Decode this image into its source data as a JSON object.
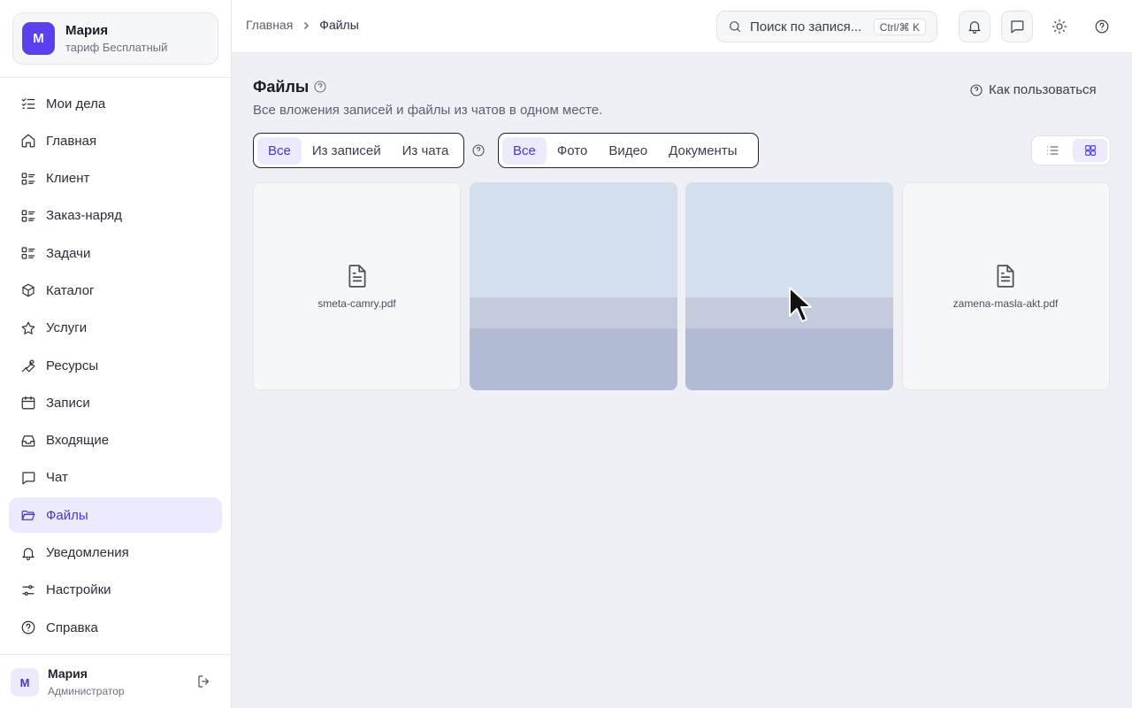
{
  "profile": {
    "initial": "М",
    "name": "Мария",
    "plan": "тариф Бесплатный"
  },
  "sidebar": {
    "items": [
      {
        "label": "Мои дела",
        "icon": "list-check-icon"
      },
      {
        "label": "Главная",
        "icon": "home-icon"
      },
      {
        "label": "Клиент",
        "icon": "list-icon"
      },
      {
        "label": "Заказ-наряд",
        "icon": "list-icon"
      },
      {
        "label": "Задачи",
        "icon": "list-icon"
      },
      {
        "label": "Каталог",
        "icon": "box-icon"
      },
      {
        "label": "Услуги",
        "icon": "star-icon"
      },
      {
        "label": "Ресурсы",
        "icon": "wrench-icon"
      },
      {
        "label": "Записи",
        "icon": "calendar-icon"
      },
      {
        "label": "Входящие",
        "icon": "inbox-icon"
      },
      {
        "label": "Чат",
        "icon": "chat-icon"
      },
      {
        "label": "Файлы",
        "icon": "folder-icon",
        "active": true
      },
      {
        "label": "Уведомления",
        "icon": "bell-icon"
      },
      {
        "label": "Настройки",
        "icon": "sliders-icon"
      },
      {
        "label": "Справка",
        "icon": "help-circle-icon"
      }
    ]
  },
  "user": {
    "initial": "М",
    "name": "Мария",
    "role": "Администратор"
  },
  "topbar": {
    "breadcrumb": {
      "home": "Главная",
      "current": "Файлы"
    },
    "search_placeholder": "Поиск по записям",
    "search_display": "Поиск по запися...",
    "shortcut": "Ctrl/⌘ K"
  },
  "page": {
    "title": "Файлы",
    "subtitle": "Все вложения записей и файлы из чатов в одном месте.",
    "howto": "Как пользоваться"
  },
  "source_filter": {
    "options": [
      "Все",
      "Из записей",
      "Из чата"
    ],
    "selected": "Все"
  },
  "type_filter": {
    "options": [
      "Все",
      "Фото",
      "Видео",
      "Документы"
    ],
    "selected": "Все"
  },
  "view_mode": "grid",
  "files": [
    {
      "kind": "document",
      "name": "smeta-camry.pdf"
    },
    {
      "kind": "image"
    },
    {
      "kind": "image"
    },
    {
      "kind": "document",
      "name": "zamena-masla-akt.pdf"
    }
  ],
  "colors": {
    "accent": "#4636d8",
    "avatar": "#5b3ff0",
    "active_bg": "#ecebfd",
    "page_bg": "#eef0f5"
  }
}
